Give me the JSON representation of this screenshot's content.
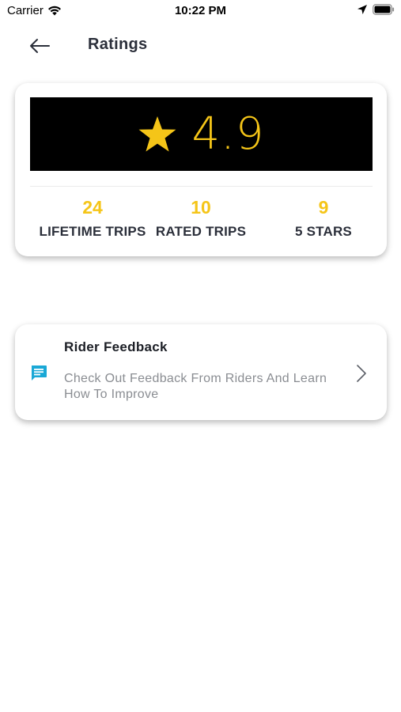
{
  "status_bar": {
    "carrier": "Carrier",
    "time": "10:22 PM",
    "icons": [
      "wifi-icon",
      "location-arrow-icon",
      "battery-icon"
    ]
  },
  "nav": {
    "title": "Ratings",
    "back_icon": "arrow-left-icon"
  },
  "ratings": {
    "rating": "4.9",
    "star_icon": "star-icon",
    "stats": [
      {
        "value": "24",
        "label": "LIFETIME TRIPS"
      },
      {
        "value": "10",
        "label": "RATED TRIPS"
      },
      {
        "value": "9",
        "label": "5 STARS"
      }
    ]
  },
  "feedback": {
    "title": "Rider Feedback",
    "description": "Check Out Feedback From Riders And Learn How To Improve",
    "icon": "chat-icon",
    "chevron_icon": "chevron-right-icon"
  },
  "colors": {
    "accent": "#f5c518",
    "banner": "#000000",
    "chat_icon": "#1aa8d6",
    "muted_text": "#8a8d92"
  }
}
